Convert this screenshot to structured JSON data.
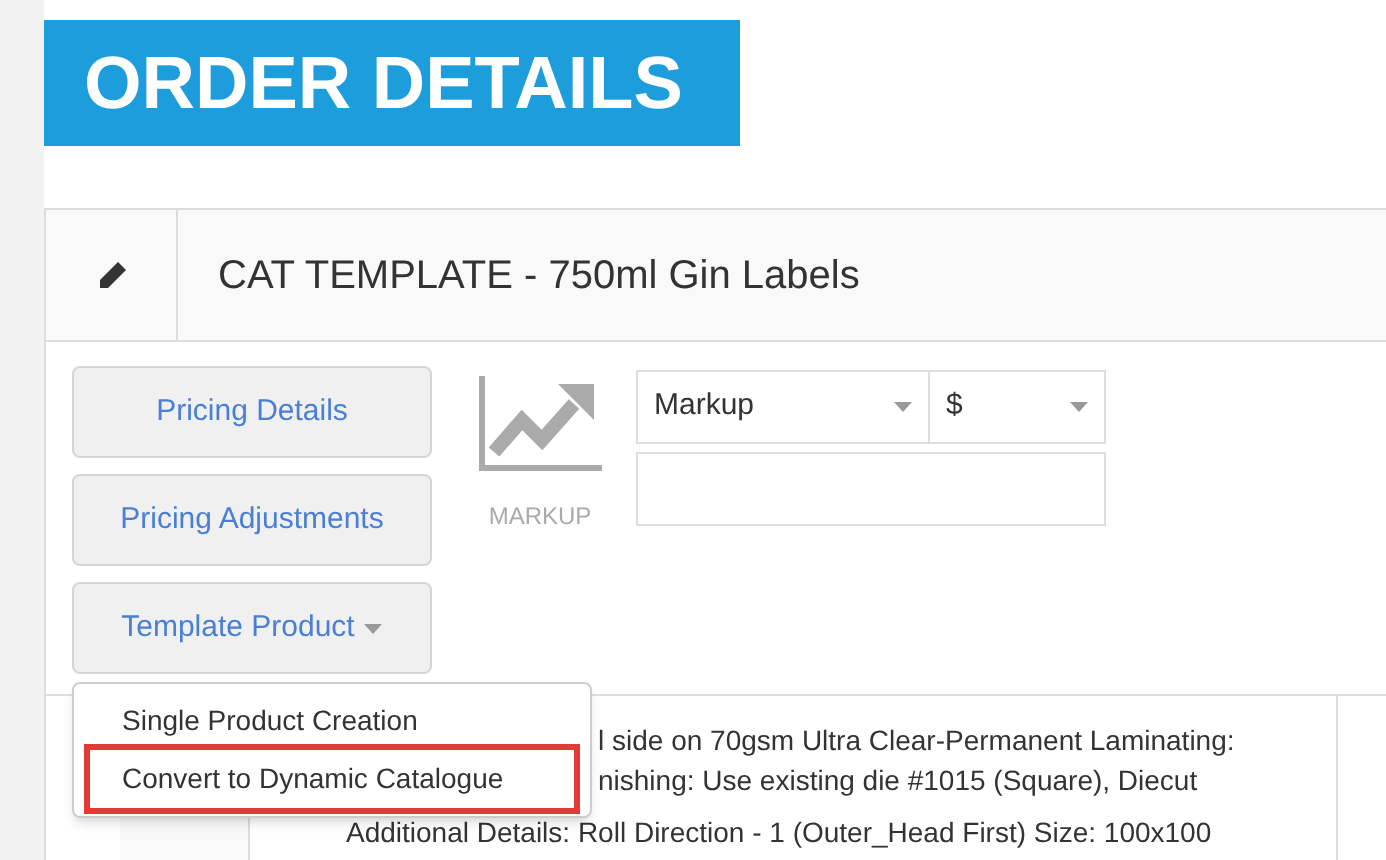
{
  "header": {
    "title": "ORDER DETAILS"
  },
  "panel": {
    "title": "CAT TEMPLATE - 750ml Gin Labels"
  },
  "buttons": [
    {
      "label": "Pricing Details",
      "dropdown": false
    },
    {
      "label": "Pricing Adjustments",
      "dropdown": false
    },
    {
      "label": "Template Product",
      "dropdown": true
    }
  ],
  "markup": {
    "label": "MARKUP"
  },
  "fields": {
    "type_select": "Markup",
    "currency_select": "$"
  },
  "description_lines": [
    "l side on 70gsm Ultra Clear-Permanent Laminating:",
    "nishing: Use existing die #1015 (Square), Diecut",
    "Additional Details: Roll Direction - 1 (Outer_Head First) Size: 100x100"
  ],
  "menu": {
    "items": [
      {
        "label": "Single Product Creation",
        "highlighted": false
      },
      {
        "label": "Convert to Dynamic Catalogue",
        "highlighted": true
      }
    ]
  }
}
